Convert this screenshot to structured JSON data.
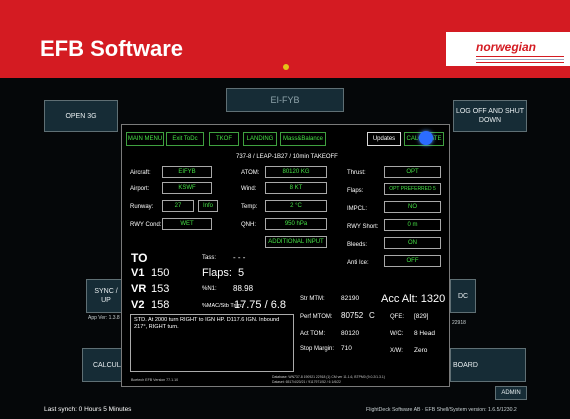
{
  "slide": {
    "title": "EFB Software",
    "logo": "norwegian"
  },
  "background": {
    "top_label": "EI-FYB",
    "open_label": "OPEN 3G",
    "logoff_label": "LOG OFF AND SHUT DOWN",
    "sync_label": "SYNC / UP",
    "app_ver": "App Ver: 1.3.8",
    "calc_label": "CALCULA",
    "right_dc": "DC",
    "right_num": "22918",
    "board_label": "BOARD",
    "admin_label": "ADMIN",
    "last_synch": "Last synch: 0 Hours  5 Minutes",
    "footer_right": "FlightDeck Software AB · EFB Shell/System version: 1.6.5/1230.2"
  },
  "dialog": {
    "menu": {
      "main_menu": "MAIN MENU",
      "exit_todc": "Exit ToDc",
      "tkof": "TKOF",
      "landing": "LANDING",
      "mass_balance": "Mass&Balance",
      "updates": "Updates",
      "calculate": "CALCULATE"
    },
    "subtitle": "737-8 / LEAP-1B27 / 10min  TAKEOFF",
    "inputs": {
      "aircraft_label": "Aircraft:",
      "aircraft": "EIFYB",
      "airport_label": "Airport:",
      "airport": "KSWF",
      "runway_label": "Runway:",
      "runway": "27",
      "info": "Info",
      "rwy_cond_label": "RWY Cond:",
      "rwy_cond": "WET",
      "atom_label": "ATOM:",
      "atom": "80120 KG",
      "wind_label": "Wind:",
      "wind": "8 KT",
      "temp_label": "Temp:",
      "temp": "2 °C",
      "qnh_label": "QNH:",
      "qnh": "950 hPa",
      "additional_input": "ADDITIONAL INPUT",
      "thrust_label": "Thrust:",
      "thrust": "OPT",
      "flaps_label": "Flaps:",
      "flaps": "OPT PREFERRED 5",
      "impcl_label": "IMPCL:",
      "impcl": "NO",
      "rwy_short_label": "RWY Short:",
      "rwy_short": "0 m",
      "bleeds_label": "Bleeds:",
      "bleeds": "ON",
      "anti_ice_label": "Anti Ice:",
      "anti_ice": "OFF"
    },
    "results": {
      "to": "TO",
      "v1_label": "V1",
      "v1": "150",
      "vr_label": "VR",
      "vr": "153",
      "v2_label": "V2",
      "v2": "158",
      "tass_label": "Tass:",
      "tass": "- - -",
      "flaps_label": "Flaps:",
      "flaps": "5",
      "n1_label": "%N1:",
      "n1": "88.98",
      "mac_label": "%MAC/Stb Trim:",
      "mac": "17.75 / 6.8",
      "str_mtm_label": "Str MTM:",
      "str_mtm": "82190",
      "perf_mtom_label": "Perf MTOM:",
      "perf_mtom": "80752",
      "perf_code": "C",
      "act_tom_label": "Act TOM:",
      "act_tom": "80120",
      "stop_margin_label": "Stop Margin:",
      "stop_margin": "710",
      "acc_alt": "Acc Alt: 1320",
      "qfe_label": "QFE:",
      "qfe": "[829]",
      "wc_label": "W/C:",
      "wc": "8 Head",
      "xw_label": "X/W:",
      "xw": "Zero"
    },
    "remarks": "STD. At 2000 turn RIGHT to IGN HP. D117.6 IGN. Inbound 217°, RIGHT turn.",
    "footer_left": "Boetech EFB Version 77.1.10",
    "footer_db1": "Database: WN737-8 190921 22918 (1) CM ver 11.1.6, BTPM0 (9.0.2/1.3.1)",
    "footer_db2": "Dataset: 6517/4/20/21 / 9117971/52 / 6 1/6/22"
  },
  "colors": {
    "header_red": "#d41b22",
    "value_green": "#45e045",
    "bg_button": "#162c36"
  }
}
